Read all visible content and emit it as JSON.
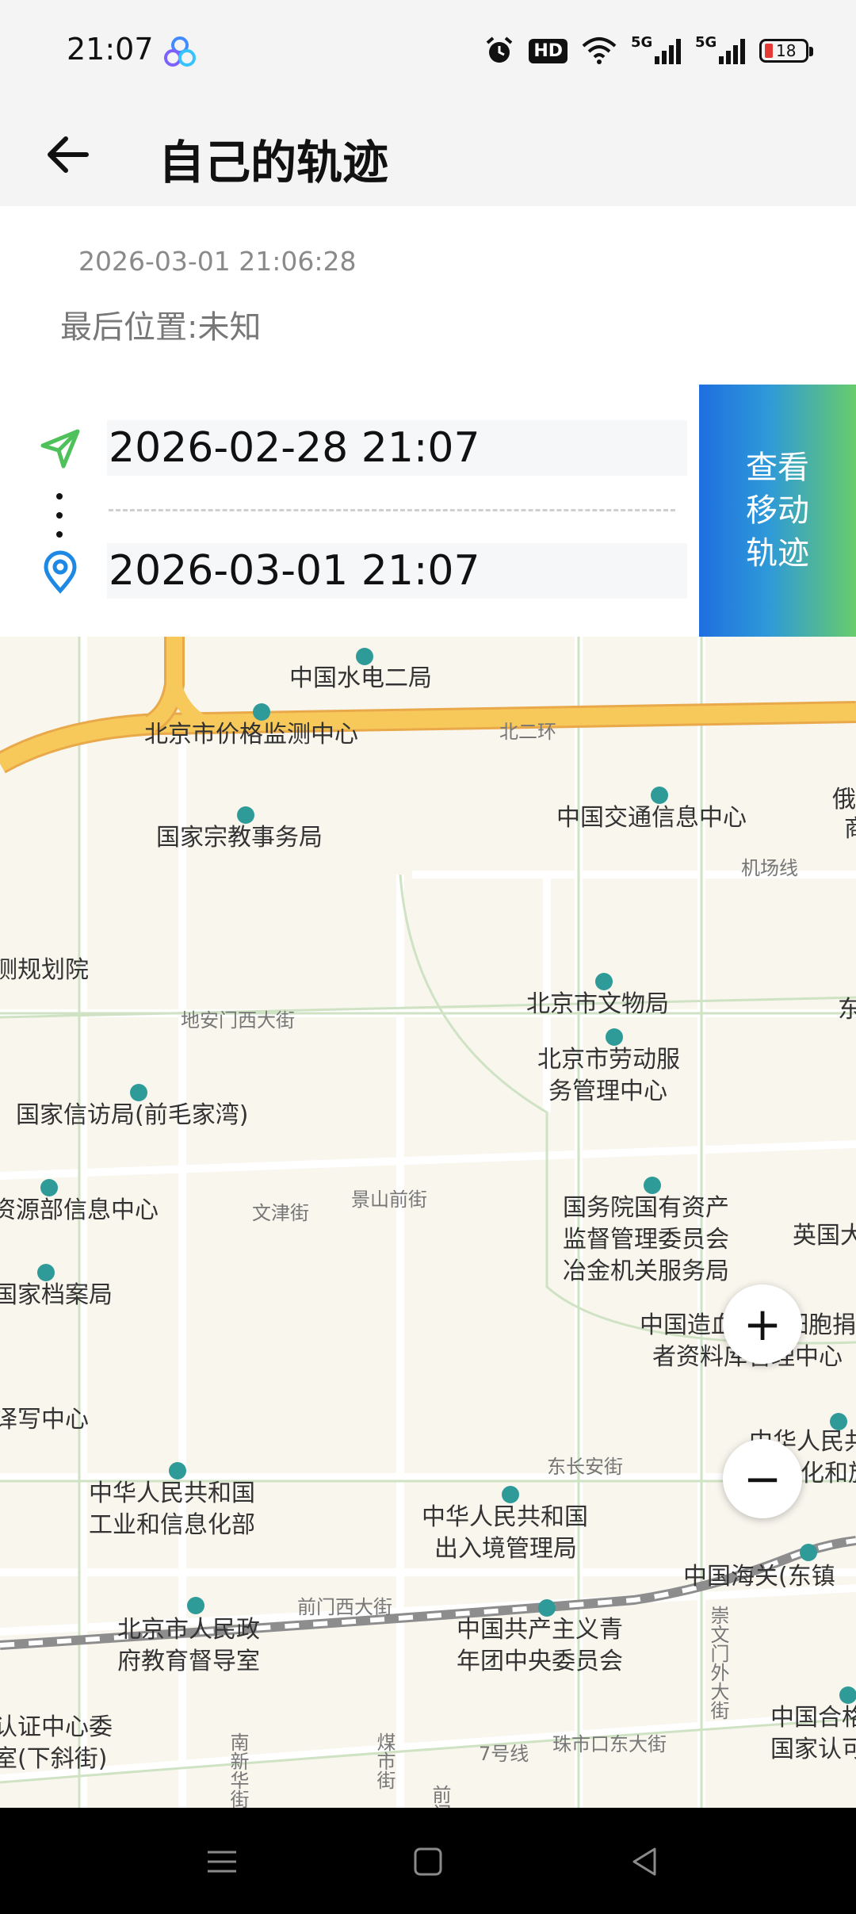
{
  "status_bar": {
    "time": "21:07",
    "hd_label": "HD",
    "signal1_label": "5G",
    "signal2_label": "5G",
    "battery_level": "18",
    "icons": [
      "app-clover-icon",
      "alarm-icon",
      "hd-icon",
      "wifi-icon",
      "signal-icon",
      "signal-icon",
      "battery-icon"
    ]
  },
  "header": {
    "title": "自己的轨迹",
    "back_icon": "arrow-left-icon"
  },
  "info": {
    "timestamp": "2026-03-01 21:06:28",
    "last_position": "最后位置:未知"
  },
  "route": {
    "start_time": "2026-02-28 21:07",
    "end_time": "2026-03-01 21:07",
    "start_icon": "navigation-arrow-icon",
    "end_icon": "location-pin-icon"
  },
  "view_track_button": {
    "line1": "查看",
    "line2": "移动",
    "line3": "轨迹"
  },
  "map": {
    "pois": [
      "中国水电二局",
      "北京市价格监测中心",
      "国家宗教事务局",
      "中国交通信息中心",
      "北京市文物局",
      "北京市劳动服",
      "务管理中心",
      "国家信访局(前毛家湾)",
      "国务院国有资产",
      "监督管理委员会",
      "冶金机关服务局",
      "英国大",
      "中国造血",
      "干细胞捐献",
      "者资料库管理中心",
      "中华人民共和国",
      "工业和信息化部",
      "中华人民共和国",
      "出入境管理局",
      "中国共产主义青",
      "年团中央委员会",
      "北京市人民政",
      "府教育督导室",
      "中国海关(东镇",
      "中国合格",
      "国家认可",
      "测规划院",
      "资源部信息中心",
      "国家档案局",
      "译写中心",
      "认证中心委",
      "室(下斜街)",
      "俄",
      "商",
      "东",
      "中华人民共",
      "化和旅"
    ],
    "roads": [
      "北二环",
      "机场线",
      "地安门西大街",
      "文津街",
      "景山前街",
      "东长安街",
      "前门西大街",
      "7号线",
      "珠市口东大街",
      "南新华街",
      "煤市街",
      "前门",
      "崇文门外大街"
    ],
    "zoom_in_label": "+",
    "zoom_out_label": "−"
  },
  "colors": {
    "accent_green": "#4fc15a",
    "accent_blue": "#1e88e5",
    "poi_dot": "#2e9b99",
    "ring_road": "#f7c85a"
  }
}
